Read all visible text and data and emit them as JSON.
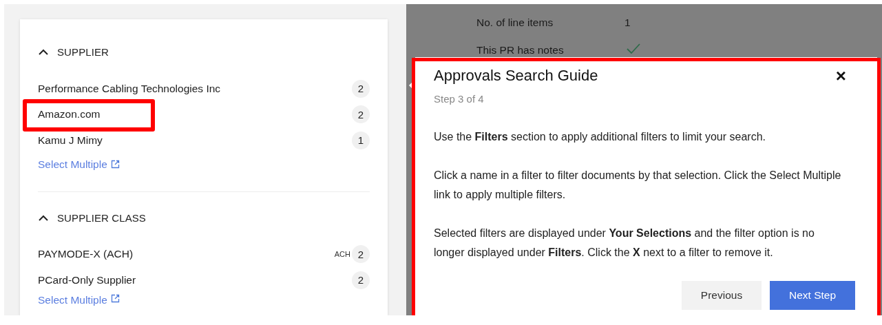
{
  "filters": [
    {
      "title": "SUPPLIER",
      "expanded": true,
      "items": [
        {
          "name": "Performance Cabling Technologies Inc",
          "count": "2",
          "highlighted": false
        },
        {
          "name": "Amazon.com",
          "count": "2",
          "highlighted": true
        },
        {
          "name": "Kamu J Mimy",
          "count": "1",
          "highlighted": false
        }
      ],
      "link": "Select Multiple"
    },
    {
      "title": "SUPPLIER CLASS",
      "expanded": true,
      "items": [
        {
          "name": "PAYMODE-X (ACH)",
          "count": "2",
          "tooltip": "ACH",
          "highlighted": false
        },
        {
          "name": "PCard-Only Supplier",
          "count": "2",
          "highlighted": false
        }
      ],
      "link": "Select Multiple"
    }
  ],
  "details": [
    {
      "label": "No. of line items",
      "value": "1",
      "kind": "text"
    },
    {
      "label": "This PR has notes",
      "kind": "check"
    }
  ],
  "guide": {
    "title": "Approvals Search Guide",
    "step": "Step 3 of 4",
    "highlighted": true,
    "paragraphs": [
      "Use the **Filters** section to apply additional filters to limit your search.",
      "Click a name in a filter to filter documents by that selection. Click the Select Multiple link to apply multiple filters.",
      "Selected filters are displayed under **Your Selections** and the filter option is no longer displayed under **Filters**. Click the **X** next to a filter to remove it."
    ],
    "close": "×",
    "buttons": [
      {
        "label": "Previous",
        "kind": "secondary"
      },
      {
        "label": "Next Step",
        "kind": "primary"
      }
    ]
  }
}
